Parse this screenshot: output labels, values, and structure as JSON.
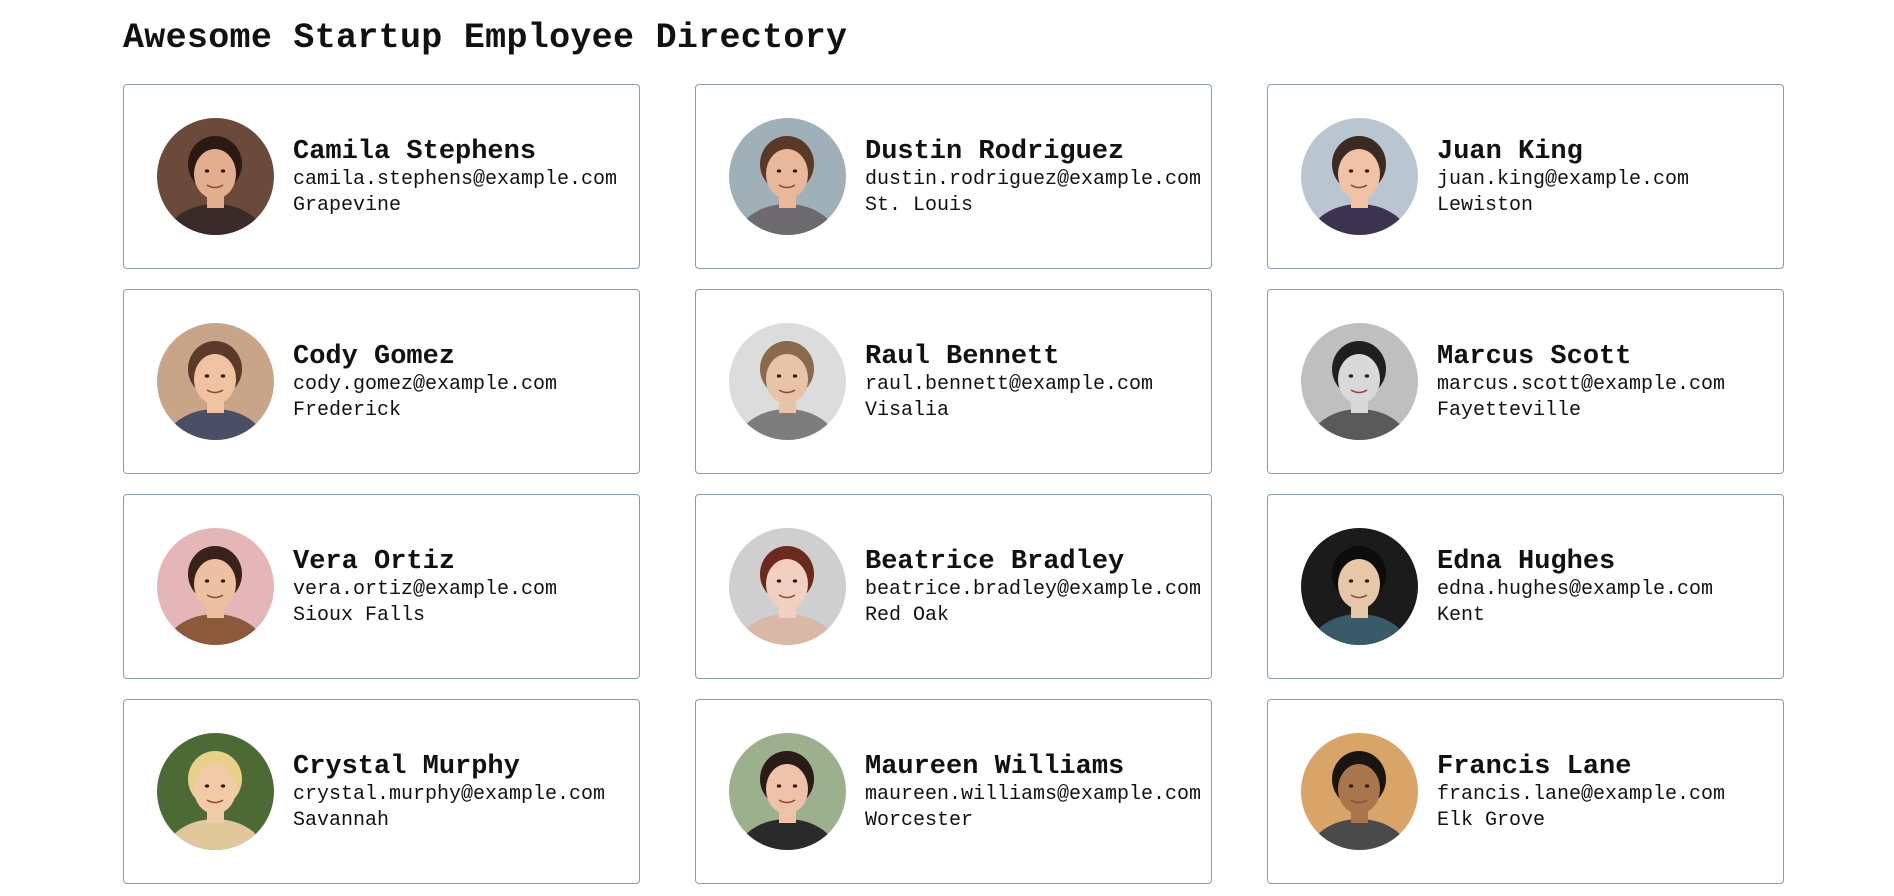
{
  "page": {
    "title": "Awesome Startup Employee Directory"
  },
  "employees": [
    {
      "name": "Camila Stephens",
      "email": "camila.stephens@example.com",
      "city": "Grapevine",
      "avatar": {
        "bg": "#6b4a3c",
        "skin": "#e3ad90",
        "hair": "#2b1a14",
        "shirt": "#3a2a2a"
      }
    },
    {
      "name": "Dustin Rodriguez",
      "email": "dustin.rodriguez@example.com",
      "city": "St. Louis",
      "avatar": {
        "bg": "#9fb0b8",
        "skin": "#e9b89a",
        "hair": "#5a3a26",
        "shirt": "#6c6a6e"
      }
    },
    {
      "name": "Juan King",
      "email": "juan.king@example.com",
      "city": "Lewiston",
      "avatar": {
        "bg": "#b9c6d2",
        "skin": "#f1c3a4",
        "hair": "#3a2a22",
        "shirt": "#3c3350"
      }
    },
    {
      "name": "Cody Gomez",
      "email": "cody.gomez@example.com",
      "city": "Frederick",
      "avatar": {
        "bg": "#c8a489",
        "skin": "#efc2a2",
        "hair": "#5b3a2a",
        "shirt": "#4a4f66"
      }
    },
    {
      "name": "Raul Bennett",
      "email": "raul.bennett@example.com",
      "city": "Visalia",
      "avatar": {
        "bg": "#dcdcdc",
        "skin": "#e9c3a8",
        "hair": "#8a6a4a",
        "shirt": "#7d7d7d"
      }
    },
    {
      "name": "Marcus Scott",
      "email": "marcus.scott@example.com",
      "city": "Fayetteville",
      "avatar": {
        "bg": "#bfbfbf",
        "skin": "#d9d9d9",
        "hair": "#1f1f1f",
        "shirt": "#5a5a5a"
      }
    },
    {
      "name": "Vera Ortiz",
      "email": "vera.ortiz@example.com",
      "city": "Sioux Falls",
      "avatar": {
        "bg": "#e4b6b8",
        "skin": "#edc0a2",
        "hair": "#3a2218",
        "shirt": "#8a5a3a"
      }
    },
    {
      "name": "Beatrice Bradley",
      "email": "beatrice.bradley@example.com",
      "city": "Red Oak",
      "avatar": {
        "bg": "#cfcfcf",
        "skin": "#f2cfc0",
        "hair": "#6a2a1e",
        "shirt": "#d9b8a8"
      }
    },
    {
      "name": "Edna Hughes",
      "email": "edna.hughes@example.com",
      "city": "Kent",
      "avatar": {
        "bg": "#1b1b1b",
        "skin": "#e6c7a8",
        "hair": "#0c0c0c",
        "shirt": "#3a5a6a"
      }
    },
    {
      "name": "Crystal Murphy",
      "email": "crystal.murphy@example.com",
      "city": "Savannah",
      "avatar": {
        "bg": "#4d6a36",
        "skin": "#f1caa8",
        "hair": "#e8cf8a",
        "shirt": "#e0c89a"
      }
    },
    {
      "name": "Maureen Williams",
      "email": "maureen.williams@example.com",
      "city": "Worcester",
      "avatar": {
        "bg": "#9db08e",
        "skin": "#edc2a8",
        "hair": "#2a1a18",
        "shirt": "#2a2a2a"
      }
    },
    {
      "name": "Francis Lane",
      "email": "francis.lane@example.com",
      "city": "Elk Grove",
      "avatar": {
        "bg": "#d8a468",
        "skin": "#a8754c",
        "hair": "#1c1410",
        "shirt": "#4a4a4a"
      }
    }
  ]
}
